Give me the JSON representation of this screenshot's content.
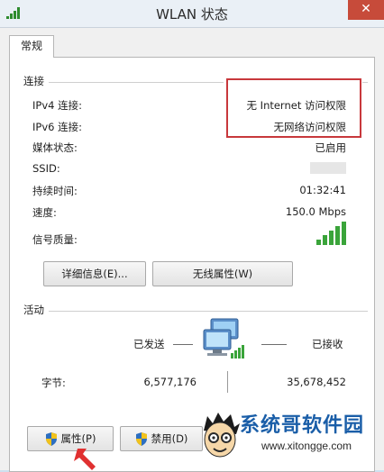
{
  "window": {
    "title": "WLAN 状态",
    "close_glyph": "✕"
  },
  "tabs": [
    {
      "label": "常规"
    }
  ],
  "connection": {
    "group_title": "连接",
    "rows": [
      {
        "label": "IPv4 连接:",
        "value": "无 Internet 访问权限"
      },
      {
        "label": "IPv6 连接:",
        "value": "无网络访问权限"
      },
      {
        "label": "媒体状态:",
        "value": "已启用"
      },
      {
        "label": "SSID:",
        "value": ""
      },
      {
        "label": "持续时间:",
        "value": "01:32:41"
      },
      {
        "label": "速度:",
        "value": "150.0 Mbps"
      },
      {
        "label": "信号质量:",
        "value": ""
      }
    ],
    "signal_bars": 5
  },
  "buttons": {
    "details": "详细信息(E)...",
    "wireless_properties": "无线属性(W)",
    "properties": "属性(P)",
    "disable": "禁用(D)"
  },
  "activity": {
    "group_title": "活动",
    "sent_label": "已发送",
    "received_label": "已接收",
    "bytes_label": "字节:",
    "bytes_sent": "6,577,176",
    "bytes_received": "35,678,452"
  },
  "watermark": {
    "text": "系统哥软件园",
    "url": "www.xitongge.com"
  },
  "colors": {
    "highlight_box": "#c8383c",
    "signal": "#3aa43a",
    "arrow": "#e03030",
    "watermark": "#1a5ea8"
  },
  "icons": [
    "wifi-icon",
    "close-icon",
    "network-computers-icon",
    "shield-icon",
    "red-arrow-icon"
  ]
}
